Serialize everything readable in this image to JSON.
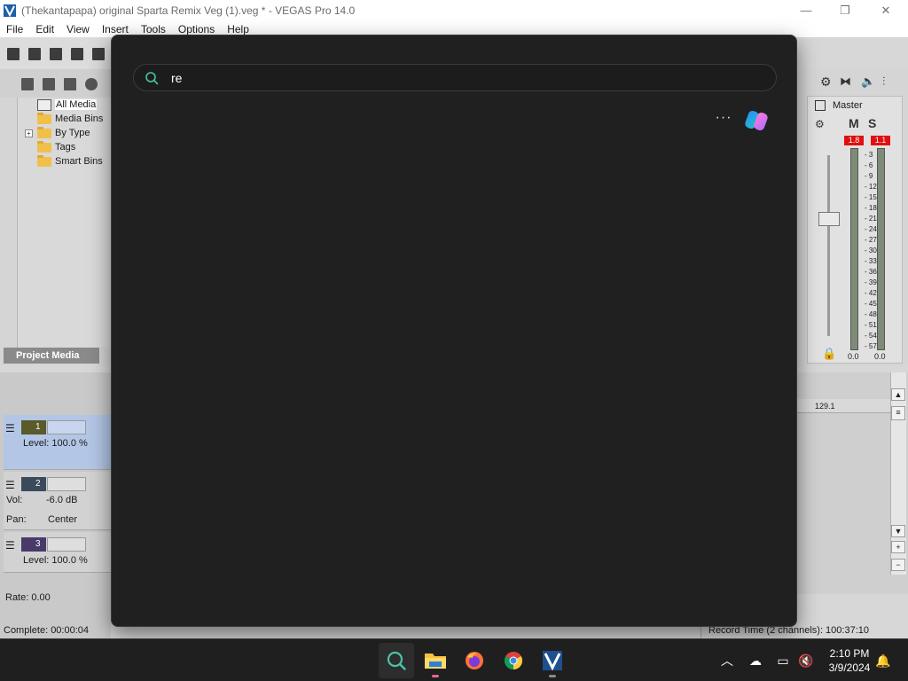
{
  "window": {
    "title": "(Thekantapapa) original Sparta Remix Veg (1).veg * - VEGAS Pro 14.0",
    "minimize": "—",
    "maximize": "❐",
    "close": "✕"
  },
  "menu": [
    "File",
    "Edit",
    "View",
    "Insert",
    "Tools",
    "Options",
    "Help"
  ],
  "project_media": {
    "tree": [
      {
        "label": "All Media"
      },
      {
        "label": "Media Bins"
      },
      {
        "label": "By Type",
        "expander": "+"
      },
      {
        "label": "Tags"
      },
      {
        "label": "Smart Bins"
      }
    ],
    "tab_label": "Project Media"
  },
  "tracks": [
    {
      "number": "1",
      "line1": "Level: 100.0 %"
    },
    {
      "number": "2",
      "vol_label": "Vol:",
      "vol_value": "-6.0 dB",
      "pan_label": "Pan:",
      "pan_value": "Center"
    },
    {
      "number": "3",
      "line1": "Level: 100.0 %"
    }
  ],
  "rate": "Rate: 0.00",
  "status": {
    "complete": "Complete: 00:00:04",
    "record_time": "Record Time (2 channels): 100:37:10"
  },
  "mixer": {
    "label": "Master",
    "mute": "M",
    "solo": "S",
    "peak_left": "1.8",
    "peak_right": "1.1",
    "scale": [
      "3",
      "6",
      "9",
      "12",
      "15",
      "18",
      "21",
      "24",
      "27",
      "30",
      "33",
      "36",
      "39",
      "42",
      "45",
      "48",
      "51",
      "54",
      "57"
    ],
    "meter_left": "0.0",
    "meter_right": "0.0"
  },
  "timeline": {
    "ruler_mark": "129.1"
  },
  "search": {
    "query": "re",
    "more": "···"
  },
  "taskbar": {
    "apps": [
      "search-icon",
      "file-explorer-icon",
      "firefox-icon",
      "chrome-icon",
      "vegas-icon"
    ],
    "time": "2:10 PM",
    "date": "3/9/2024"
  },
  "colors": {
    "search_panel_bg": "#202020",
    "search_accent": "#4cc2a4",
    "taskbar_bg": "#1f1f1f",
    "peak_red": "#e01010"
  }
}
